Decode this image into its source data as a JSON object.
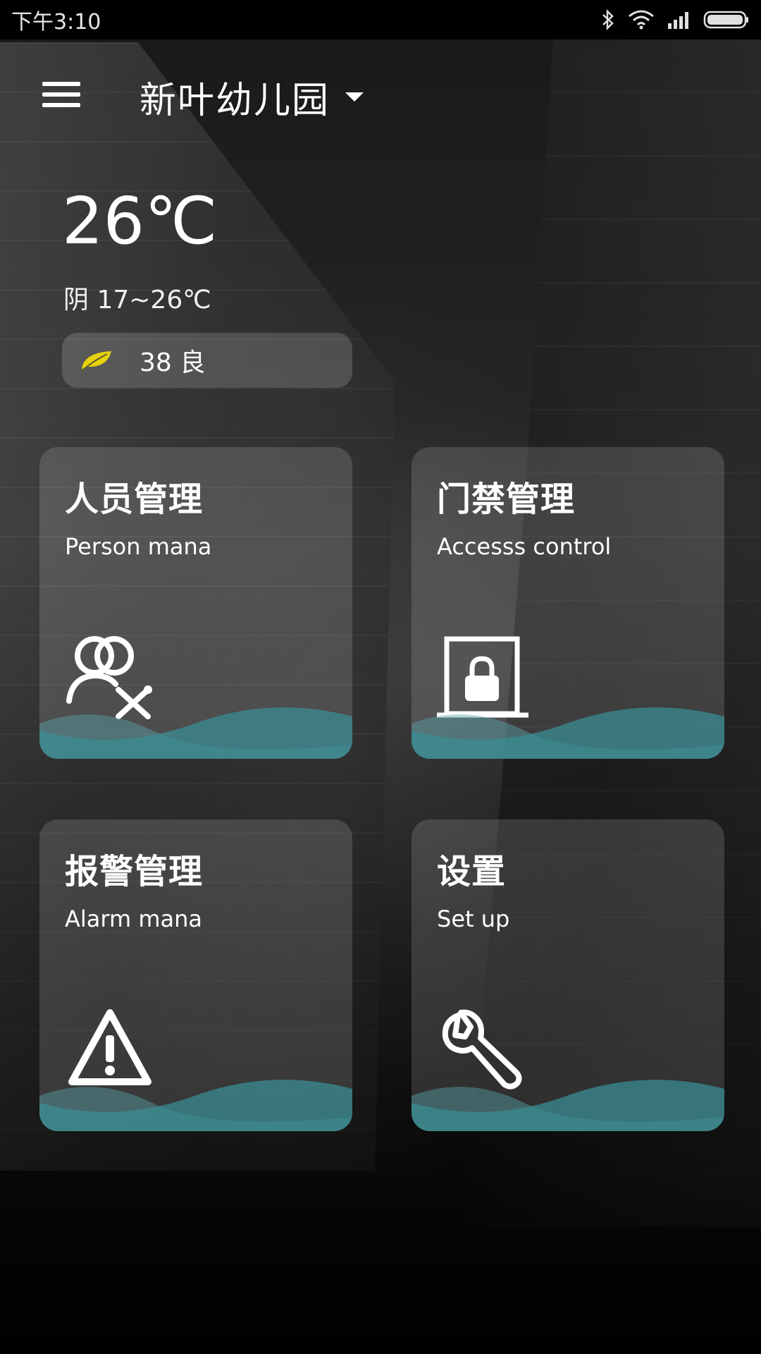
{
  "status_bar": {
    "time": "下午3:10",
    "icons": [
      "bluetooth-icon",
      "wifi-icon",
      "signal-icon",
      "battery-icon"
    ]
  },
  "app_bar": {
    "menu_icon": "hamburger-menu-icon",
    "title": "新叶幼儿园",
    "dropdown_icon": "caret-down-icon"
  },
  "weather": {
    "temperature": "26℃",
    "condition": "阴 17~26℃",
    "aqi": "38 良",
    "aqi_icon": "leaf-icon",
    "aqi_icon_color": "#e6d20f"
  },
  "tiles": [
    {
      "title": "人员管理",
      "subtitle": "Person mana",
      "icon": "person-management-icon"
    },
    {
      "title": "门禁管理",
      "subtitle": "Accesss control",
      "icon": "door-lock-icon"
    },
    {
      "title": "报警管理",
      "subtitle": "Alarm mana",
      "icon": "warning-icon"
    },
    {
      "title": "设置",
      "subtitle": "Set up",
      "icon": "wrench-icon"
    }
  ],
  "colors": {
    "wave_front": "#3a8c93",
    "wave_back": "#5aa5ab",
    "tile_background": "rgba(255,255,255,0.14)"
  }
}
